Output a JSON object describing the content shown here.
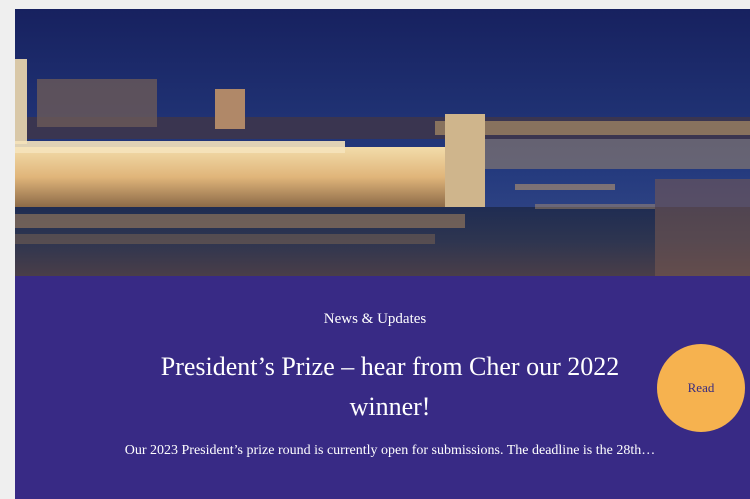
{
  "card": {
    "category": "News & Updates",
    "title": "President’s Prize – hear from Cher our 2022 winner!",
    "excerpt": "Our 2023 President’s prize round is currently open for submissions. The deadline is the 28th…",
    "read_label": "Read"
  },
  "colors": {
    "card_background": "#382a85",
    "read_button": "#f6b24f",
    "page_background": "#efefef"
  }
}
